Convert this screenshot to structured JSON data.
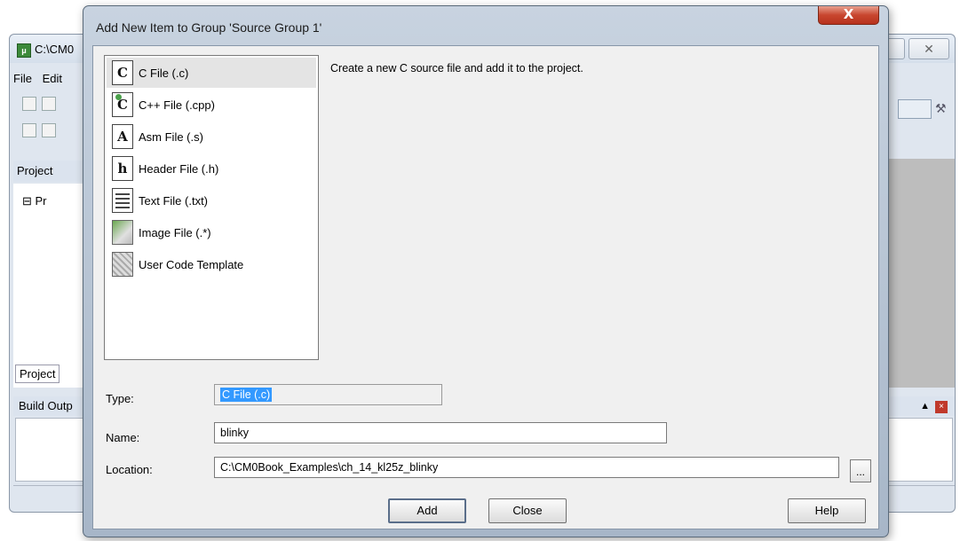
{
  "background_window": {
    "title": "C:\\CM0",
    "menu": [
      "File",
      "Edit"
    ],
    "project_panel_label": "Project",
    "project_tree_item": "Pr",
    "project_tab_label": "Project",
    "build_output_label": "Build Outp",
    "close_glyph": "✕"
  },
  "dialog": {
    "title": "Add New Item to Group 'Source Group 1'",
    "close_glyph": "X",
    "templates": [
      {
        "label": "C File (.c)",
        "icon_text": "C",
        "icon": "c-file-icon"
      },
      {
        "label": "C++ File (.cpp)",
        "icon_text": "C",
        "icon": "cpp-file-icon"
      },
      {
        "label": "Asm File (.s)",
        "icon_text": "A",
        "icon": "asm-file-icon"
      },
      {
        "label": "Header File (.h)",
        "icon_text": "h",
        "icon": "header-file-icon"
      },
      {
        "label": "Text File (.txt)",
        "icon_text": "",
        "icon": "text-file-icon"
      },
      {
        "label": "Image File (.*)",
        "icon_text": "",
        "icon": "image-file-icon"
      },
      {
        "label": "User Code Template",
        "icon_text": "",
        "icon": "user-code-template-icon"
      }
    ],
    "selected_template": "C File (.c)",
    "description": "Create a new C source file and add it to the project.",
    "type_label": "Type:",
    "type_value": "C File (.c)",
    "name_label": "Name:",
    "name_value": "blinky",
    "location_label": "Location:",
    "location_value": "C:\\CM0Book_Examples\\ch_14_kl25z_blinky",
    "browse_label": "...",
    "add_label": "Add",
    "close_label": "Close",
    "help_label": "Help"
  }
}
